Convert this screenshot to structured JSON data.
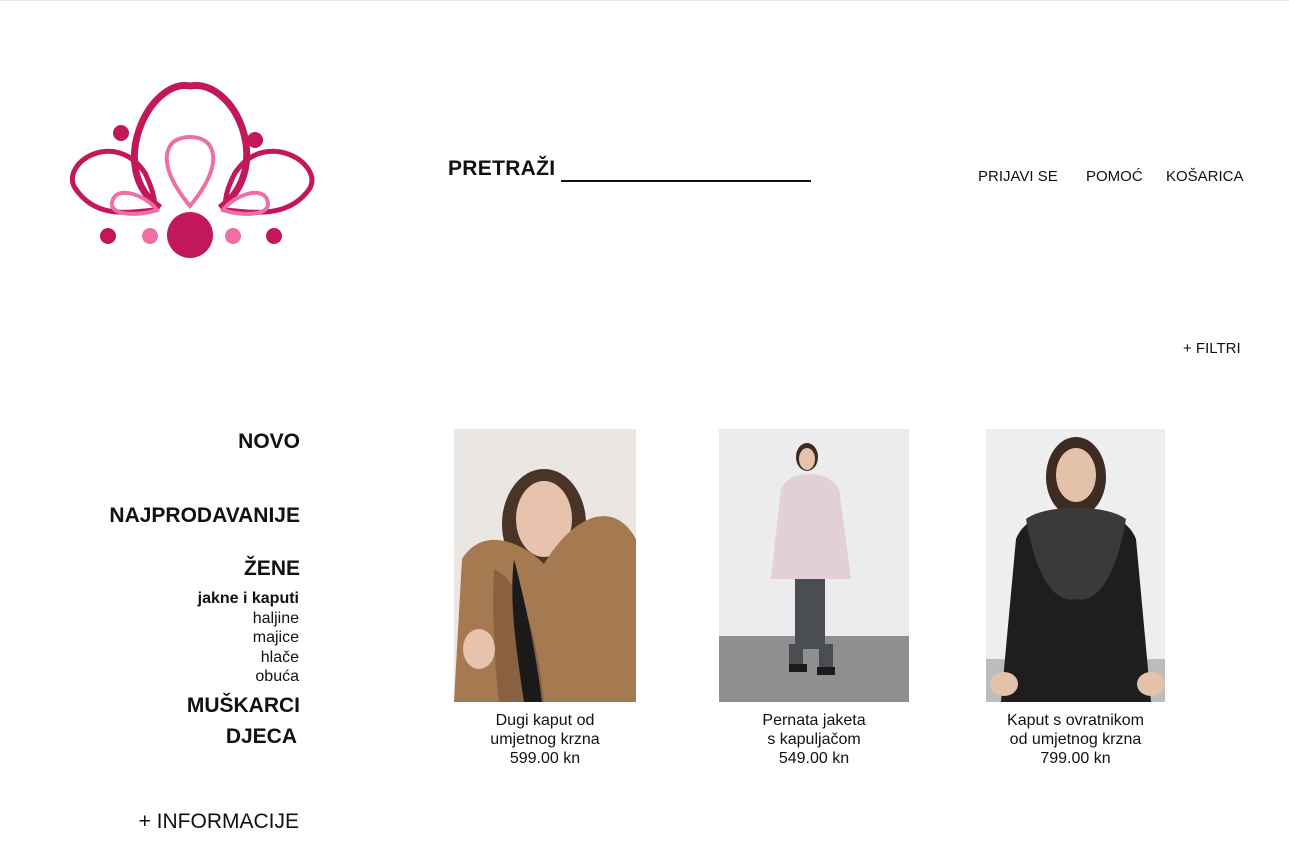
{
  "header": {
    "search_label": "PRETRAŽI",
    "search_value": "",
    "nav": [
      "PRIJAVI SE",
      "POMOĆ",
      "KOŠARICA"
    ]
  },
  "toolbar": {
    "filters_label": "+ FILTRI"
  },
  "sidebar": {
    "categories": [
      "NOVO",
      "NAJPRODAVANIJE",
      "ŽENE",
      "MUŠKARCI",
      "DJECA"
    ],
    "women_subcategories": [
      "jakne i kaputi",
      "haljine",
      "majice",
      "hlače",
      "obuća"
    ],
    "active_subcategory": "jakne i kaputi",
    "info_label": "+ INFORMACIJE"
  },
  "products": [
    {
      "name_line1": "Dugi kaput od",
      "name_line2": "umjetnog krzna",
      "price": "599.00 kn"
    },
    {
      "name_line1": "Pernata jaketa",
      "name_line2": "s kapuljačom",
      "price": "549.00 kn"
    },
    {
      "name_line1": "Kaput s ovratnikom",
      "name_line2": "od umjetnog krzna",
      "price": "799.00 kn"
    }
  ],
  "colors": {
    "brand_dark": "#c2185b",
    "brand_light": "#ee6fa5",
    "text": "#111111"
  },
  "icons": {
    "logo": "lotus-flower-logo"
  }
}
